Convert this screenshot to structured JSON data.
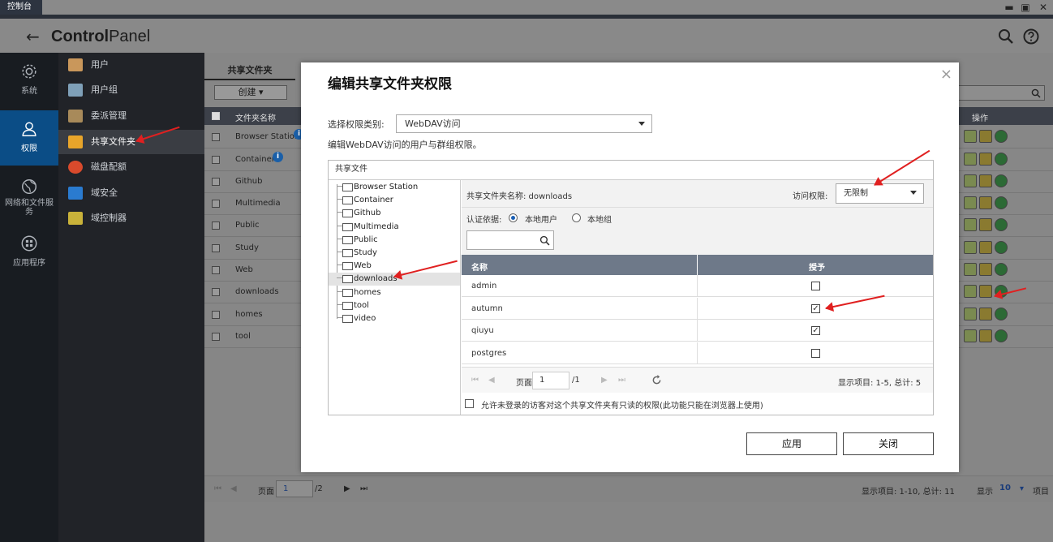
{
  "os": {
    "window_title": "控制台",
    "minimize": "▬",
    "maximize": "▣",
    "close": "✕"
  },
  "app": {
    "back": "←",
    "title_bold": "Control",
    "title_rest": "Panel"
  },
  "nav": [
    {
      "label": "系统"
    },
    {
      "label": "权限"
    },
    {
      "label": "网络和文件服务"
    },
    {
      "label": "应用程序"
    }
  ],
  "subnav": [
    {
      "label": "用户"
    },
    {
      "label": "用户组"
    },
    {
      "label": "委派管理"
    },
    {
      "label": "共享文件夹"
    },
    {
      "label": "磁盘配额"
    },
    {
      "label": "域安全"
    },
    {
      "label": "域控制器"
    }
  ],
  "bg": {
    "tab": "共享文件夹",
    "create": "创建",
    "col_name": "文件夹名称",
    "col_ops": "操作",
    "rows": [
      "Browser Station",
      "Container",
      "Github",
      "Multimedia",
      "Public",
      "Study",
      "Web",
      "downloads",
      "homes",
      "tool"
    ],
    "footer": {
      "page_label": "页面",
      "page_value": "1",
      "page_total": "/2",
      "items": "显示项目: 1-10, 总计: 11",
      "show_label": "显示",
      "show_value": "10",
      "items_label": "项目"
    }
  },
  "modal": {
    "title": "编辑共享文件夹权限",
    "close": "×",
    "perm_type_label": "选择权限类别:",
    "perm_type_value": "WebDAV访问",
    "perm_desc": "编辑WebDAV访问的用户与群组权限。",
    "panel_title": "共享文件",
    "tree": [
      "Browser Station",
      "Container",
      "Github",
      "Multimedia",
      "Public",
      "Study",
      "Web",
      "downloads",
      "homes",
      "tool",
      "video"
    ],
    "folder_name": "共享文件夹名称: downloads",
    "access_label": "访问权限:",
    "access_value": "无限制",
    "auth_label": "认证依据:",
    "auth_local_user": "本地用户",
    "auth_local_group": "本地组",
    "col_name": "名称",
    "col_grant": "授予",
    "users": [
      {
        "name": "admin",
        "granted": ""
      },
      {
        "name": "autumn",
        "granted": "✓"
      },
      {
        "name": "qiuyu",
        "granted": "✓"
      },
      {
        "name": "postgres",
        "granted": ""
      }
    ],
    "pager": {
      "page_label": "页面",
      "page_value": "1",
      "page_total": "/1",
      "items": "显示项目: 1-5, 总计: 5"
    },
    "guest_option": "允许未登录的访客对这个共享文件夹有只读的权限(此功能只能在浏览器上使用)",
    "apply": "应用",
    "close_btn": "关闭"
  },
  "colors": {
    "active_nav": "#0b4d86",
    "table_head": "#6e7989",
    "annotation": "#e02020"
  }
}
